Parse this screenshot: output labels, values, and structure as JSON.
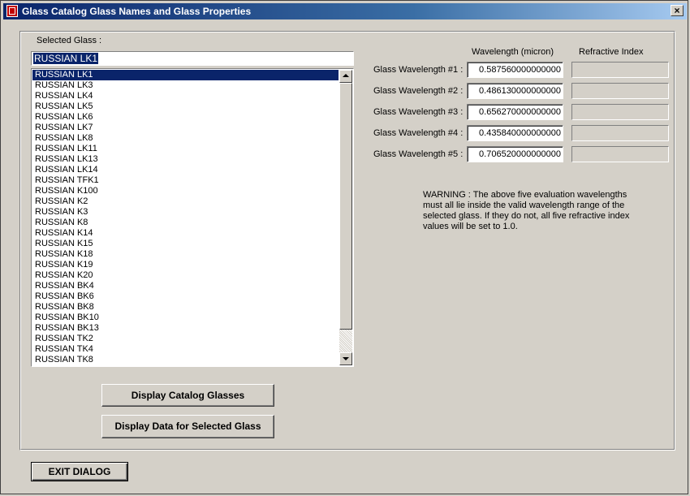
{
  "window": {
    "title": "Glass Catalog Glass Names and Glass Properties",
    "close_glyph": "×"
  },
  "selected_glass": {
    "label": "Selected Glass :",
    "value": "RUSSIAN LK1"
  },
  "glass_list": {
    "selected_index": 0,
    "items": [
      "RUSSIAN LK1",
      "RUSSIAN LK3",
      "RUSSIAN LK4",
      "RUSSIAN LK5",
      "RUSSIAN LK6",
      "RUSSIAN LK7",
      "RUSSIAN LK8",
      "RUSSIAN LK11",
      "RUSSIAN LK13",
      "RUSSIAN LK14",
      "RUSSIAN TFK1",
      "RUSSIAN K100",
      "RUSSIAN K2",
      "RUSSIAN K3",
      "RUSSIAN K8",
      "RUSSIAN K14",
      "RUSSIAN K15",
      "RUSSIAN K18",
      "RUSSIAN K19",
      "RUSSIAN K20",
      "RUSSIAN BK4",
      "RUSSIAN BK6",
      "RUSSIAN BK8",
      "RUSSIAN BK10",
      "RUSSIAN BK13",
      "RUSSIAN TK2",
      "RUSSIAN TK4",
      "RUSSIAN TK8"
    ]
  },
  "wavelengths": {
    "header_wavelength": "Wavelength (micron)",
    "header_index": "Refractive Index",
    "rows": [
      {
        "label": "Glass Wavelength #1 :",
        "value": "0.587560000000000",
        "index": ""
      },
      {
        "label": "Glass Wavelength #2 :",
        "value": "0.486130000000000",
        "index": ""
      },
      {
        "label": "Glass Wavelength #3 :",
        "value": "0.656270000000000",
        "index": ""
      },
      {
        "label": "Glass Wavelength #4 :",
        "value": "0.435840000000000",
        "index": ""
      },
      {
        "label": "Glass Wavelength #5 :",
        "value": "0.706520000000000",
        "index": ""
      }
    ]
  },
  "warning": "WARNING : The above five evaluation wavelengths must all lie inside the valid wavelength range of the selected glass. If they do not, all five refractive index values will be set to 1.0.",
  "buttons": {
    "display_catalog": "Display Catalog Glasses",
    "display_selected": "Display Data for Selected Glass",
    "exit": "EXIT DIALOG"
  }
}
